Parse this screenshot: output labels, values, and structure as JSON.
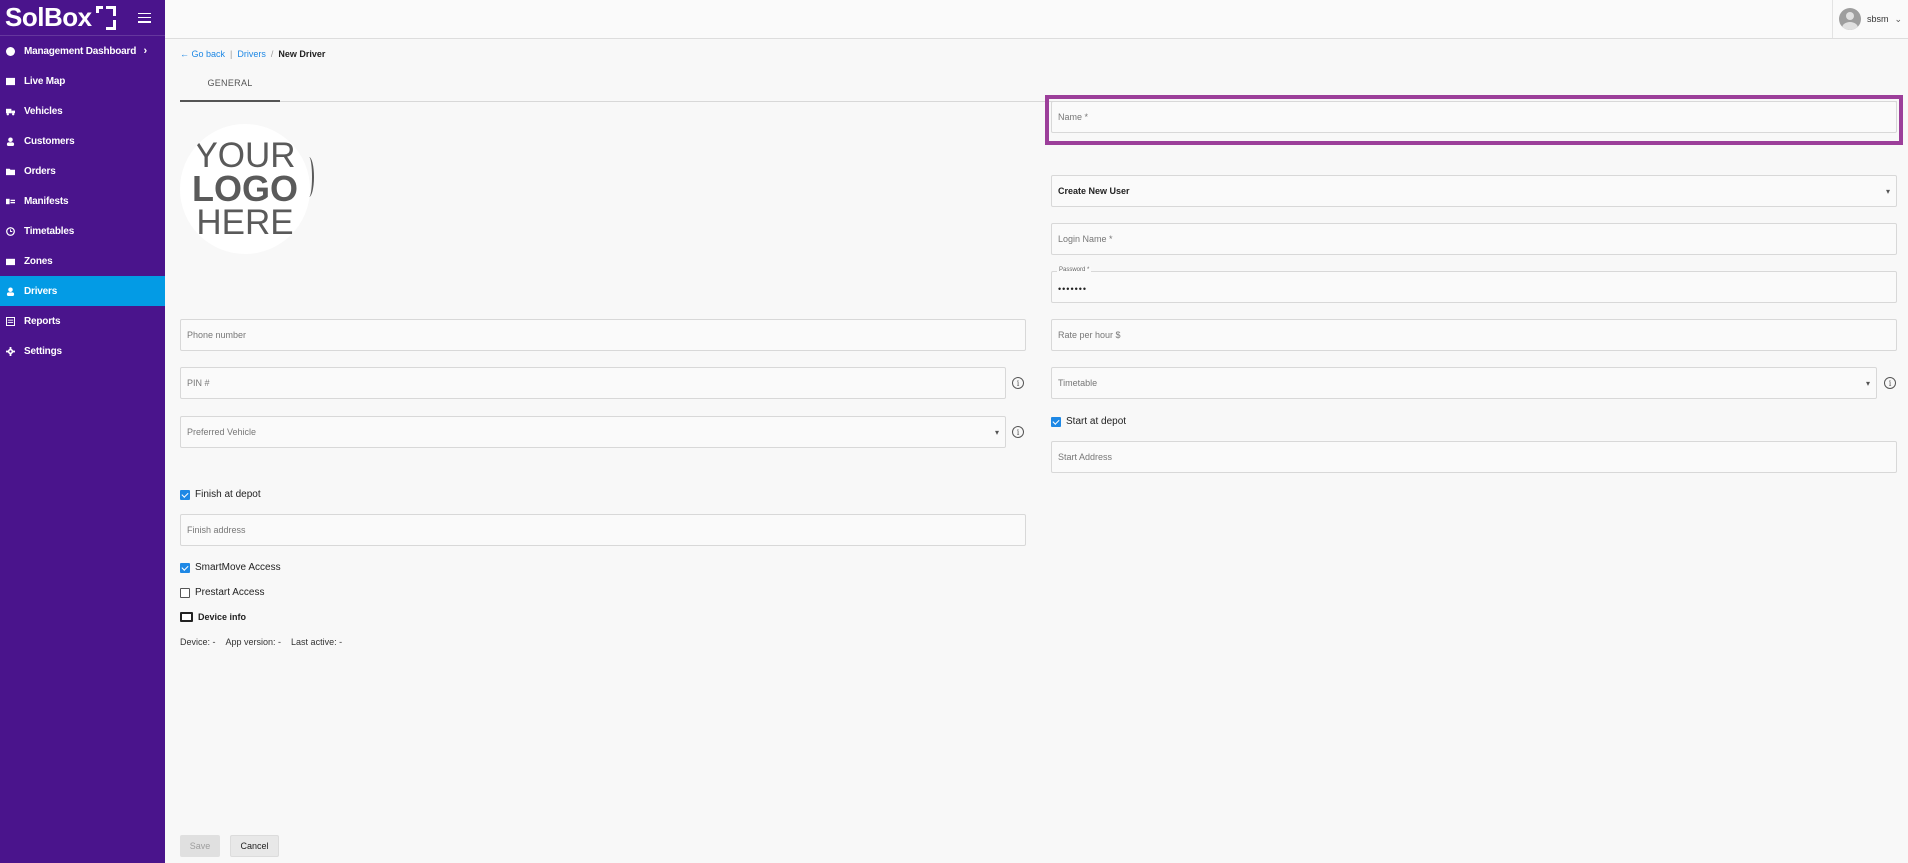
{
  "brand": {
    "name": "SolBox"
  },
  "sidebar": {
    "items": [
      {
        "label": "Management Dashboard",
        "icon": "dashboard-icon",
        "chevron": "›"
      },
      {
        "label": "Live Map",
        "icon": "map-icon"
      },
      {
        "label": "Vehicles",
        "icon": "truck-icon"
      },
      {
        "label": "Customers",
        "icon": "person-icon"
      },
      {
        "label": "Orders",
        "icon": "folder-icon"
      },
      {
        "label": "Manifests",
        "icon": "manifest-icon"
      },
      {
        "label": "Timetables",
        "icon": "clock-icon"
      },
      {
        "label": "Zones",
        "icon": "zone-icon"
      },
      {
        "label": "Drivers",
        "icon": "person-icon",
        "active": true
      },
      {
        "label": "Reports",
        "icon": "report-icon"
      },
      {
        "label": "Settings",
        "icon": "gear-icon"
      }
    ]
  },
  "topbar": {
    "username": "sbsm",
    "chevron": "⌄"
  },
  "breadcrumb": {
    "back": "Go back",
    "sep1": "|",
    "parent": "Drivers",
    "sep2": "/",
    "current": "New Driver",
    "arrow": "←"
  },
  "tabs": [
    {
      "label": "GENERAL"
    }
  ],
  "logo": {
    "line1": "YOUR",
    "line2": "LOGO",
    "line3": "HERE"
  },
  "form": {
    "name_placeholder": "Name *",
    "user_select_value": "Create New User",
    "login_placeholder": "Login Name *",
    "password_label": "Password *",
    "password_value": "•••••••",
    "phone_placeholder": "Phone number",
    "rate_placeholder": "Rate per hour $",
    "pin_placeholder": "PIN #",
    "timetable_placeholder": "Timetable",
    "vehicle_placeholder": "Preferred Vehicle",
    "start_depot_label": "Start at depot",
    "start_address_placeholder": "Start Address",
    "finish_depot_label": "Finish at depot",
    "finish_address_placeholder": "Finish address",
    "smartmove_label": "SmartMove Access",
    "prestart_label": "Prestart Access",
    "device_info_label": "Device info",
    "device_text": "Device: -",
    "app_version_text": "App version: -",
    "last_active_text": "Last active: -",
    "caret": "▾",
    "info_glyph": "i"
  },
  "actions": {
    "save": "Save",
    "cancel": "Cancel"
  },
  "colors": {
    "sidebar": "#4a148c",
    "active": "#039be5",
    "highlight": "#9c3f9a",
    "link": "#1e88e5"
  }
}
